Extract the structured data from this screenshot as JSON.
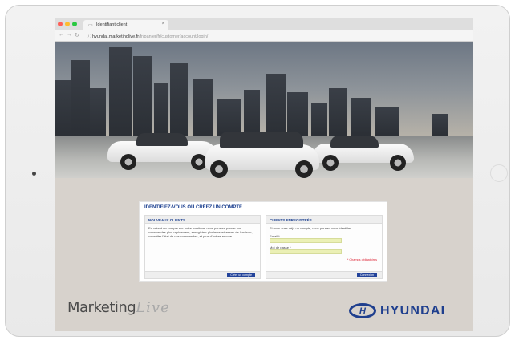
{
  "browser": {
    "tab_title": "Identifiant client",
    "url_domain": "hyundai.marketinglive.fr",
    "url_path": "/fr/panier/fr/customer/account/login/",
    "colors": {
      "close": "#ff5f57",
      "minimize": "#febc2e",
      "zoom": "#28c840"
    }
  },
  "dialog": {
    "title": "IDENTIFIEZ-VOUS OU CRÉEZ UN COMPTE",
    "new_clients": {
      "heading": "NOUVEAUX CLIENTS",
      "text": "En créant un compte sur notre boutique, vous pourrez passer vos commandes plus rapidement, enregistrer plusieurs adresses de livraison, consulter l'état de vos commandes, et plus d'autres encore.",
      "button": "Créer un compte"
    },
    "registered_clients": {
      "heading": "CLIENTS ENREGISTRÉS",
      "text": "Si vous avez déjà un compte, vous pouvez vous identifier.",
      "email_label": "Email *",
      "password_label": "Mot de passe *",
      "required_note": "* Champs obligatoires",
      "button": "Connexion"
    }
  },
  "footer": {
    "brand_left_main": "Marketing",
    "brand_left_script": "Live",
    "brand_right_mark": "H",
    "brand_right": "HYUNDAI"
  },
  "colors": {
    "accent": "#1f3f8e",
    "field_bg": "#ebf0b5"
  }
}
